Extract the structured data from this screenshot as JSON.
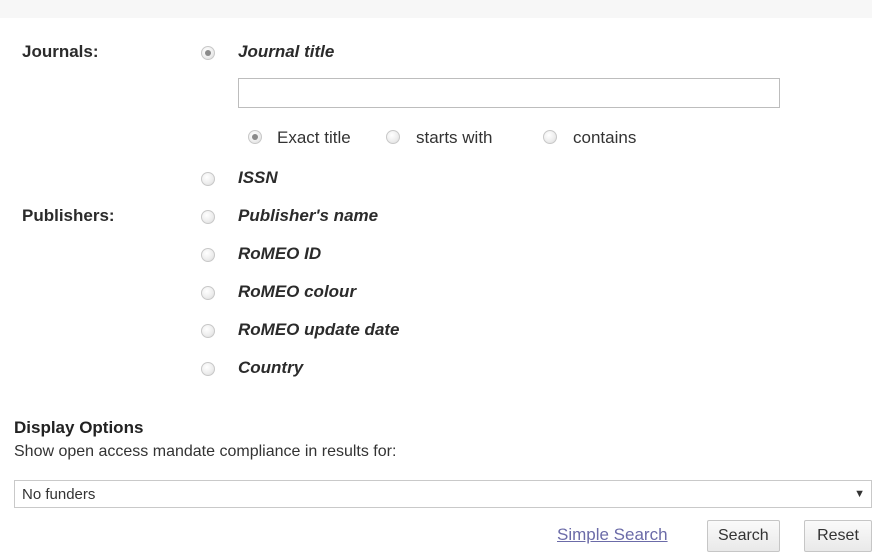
{
  "journals": {
    "section_label": "Journals:",
    "options": {
      "journal_title": {
        "label": "Journal title",
        "checked": true
      },
      "issn": {
        "label": "ISSN",
        "checked": false
      }
    },
    "journal_title_value": "",
    "match_modes": {
      "exact": {
        "label": "Exact title",
        "checked": true
      },
      "starts_with": {
        "label": "starts with",
        "checked": false
      },
      "contains": {
        "label": "contains",
        "checked": false
      }
    }
  },
  "publishers": {
    "section_label": "Publishers:",
    "options": {
      "publisher_name": {
        "label": "Publisher's name",
        "checked": false
      },
      "romeo_id": {
        "label": "RoMEO ID",
        "checked": false
      },
      "romeo_colour": {
        "label": "RoMEO colour",
        "checked": false
      },
      "romeo_update_date": {
        "label": "RoMEO update date",
        "checked": false
      },
      "country": {
        "label": "Country",
        "checked": false
      }
    }
  },
  "display_options": {
    "title": "Display Options",
    "description": "Show open access mandate compliance in results for:",
    "funder_select": {
      "value": "No funders",
      "arrow": "▼"
    }
  },
  "actions": {
    "simple_search_link": "Simple Search",
    "search_button": "Search",
    "reset_button": "Reset"
  }
}
